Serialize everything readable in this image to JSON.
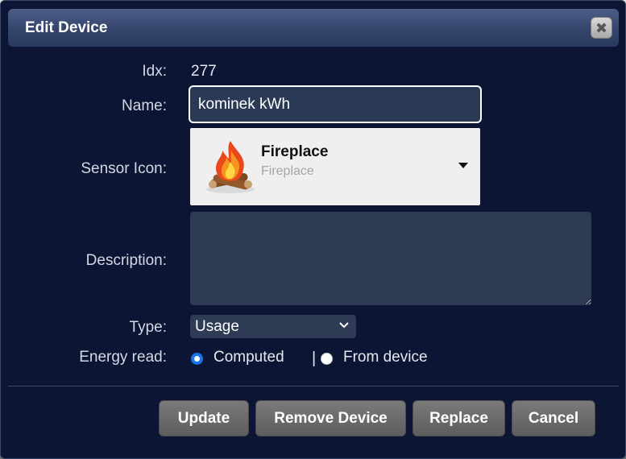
{
  "dialog": {
    "title": "Edit Device",
    "close_icon": "close-icon"
  },
  "fields": {
    "idx_label": "Idx:",
    "idx_value": "277",
    "name_label": "Name:",
    "name_value": "kominek kWh",
    "sensor_icon_label": "Sensor Icon:",
    "sensor_icon": {
      "title": "Fireplace",
      "subtitle": "Fireplace",
      "icon": "fireplace-icon"
    },
    "description_label": "Description:",
    "description_value": "",
    "type_label": "Type:",
    "type_value": "Usage",
    "energy_read_label": "Energy read:",
    "energy_options": [
      {
        "label": "Computed",
        "checked": true
      },
      {
        "label": "From device",
        "checked": false
      }
    ],
    "separator": "|"
  },
  "buttons": {
    "update": "Update",
    "remove": "Remove Device",
    "replace": "Replace",
    "cancel": "Cancel"
  },
  "colors": {
    "dialog_bg": "#0c1634",
    "titlebar": "#34446b",
    "input_bg": "#2d3b54",
    "radio_accent": "#1a73e8",
    "button_bg": "#6b6b6b"
  }
}
